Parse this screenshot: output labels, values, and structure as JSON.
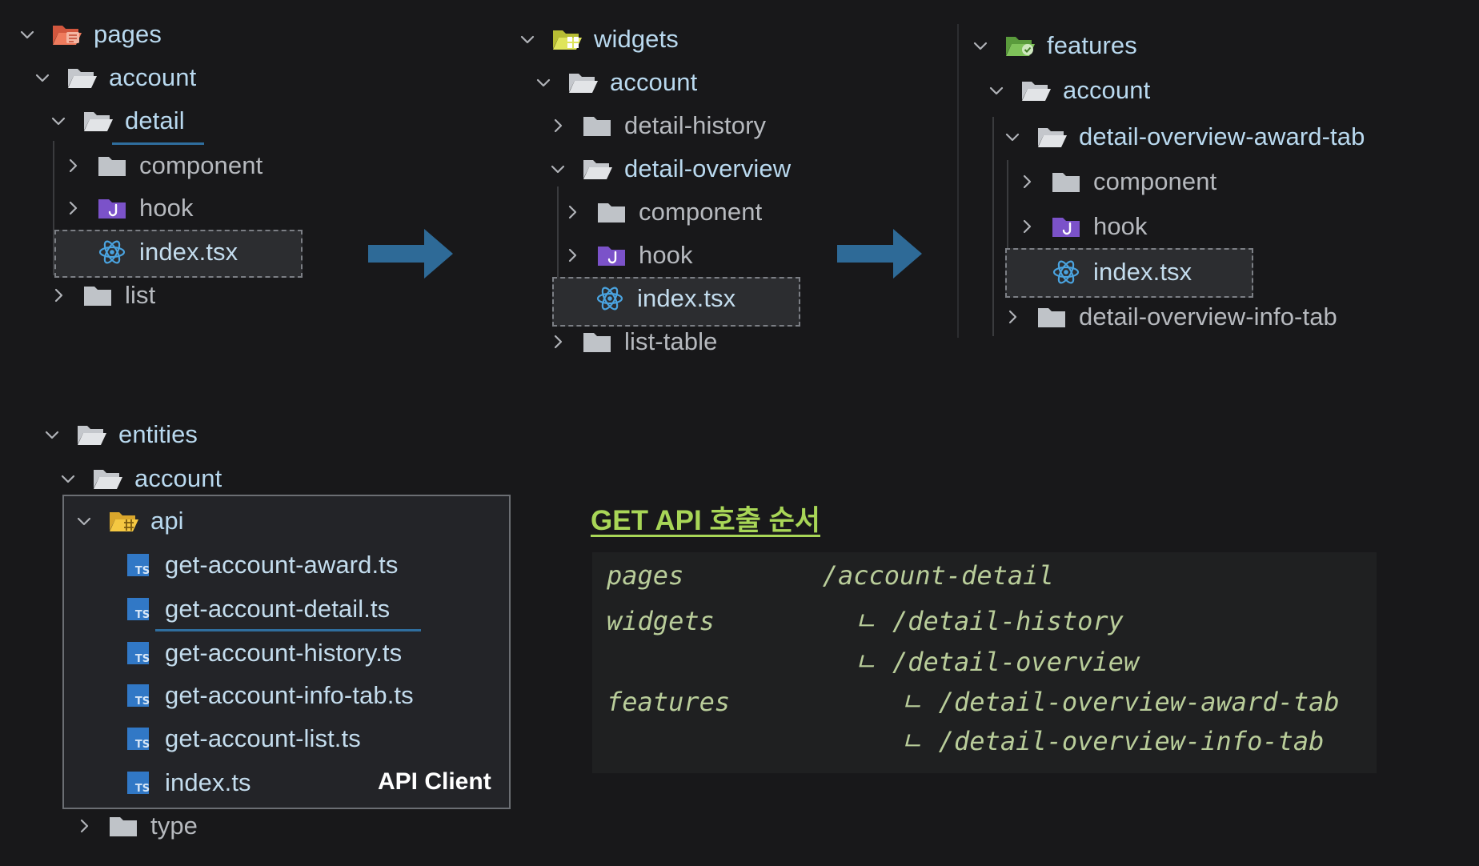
{
  "pages_tree": {
    "root": "pages",
    "account": "account",
    "detail": "detail",
    "component": "component",
    "hook": "hook",
    "index": "index.tsx",
    "list": "list"
  },
  "widgets_tree": {
    "root": "widgets",
    "account": "account",
    "detail_history": "detail-history",
    "detail_overview": "detail-overview",
    "component": "component",
    "hook": "hook",
    "index": "index.tsx",
    "list_table": "list-table"
  },
  "features_tree": {
    "root": "features",
    "account": "account",
    "award_tab": "detail-overview-award-tab",
    "component": "component",
    "hook": "hook",
    "index": "index.tsx",
    "info_tab": "detail-overview-info-tab"
  },
  "entities_tree": {
    "root": "entities",
    "account": "account",
    "api": "api",
    "files": [
      "get-account-award.ts",
      "get-account-detail.ts",
      "get-account-history.ts",
      "get-account-info-tab.ts",
      "get-account-list.ts",
      "index.ts"
    ],
    "type": "type",
    "api_client_label": "API Client"
  },
  "api_order": {
    "title": "GET API 호출 순서",
    "lines": [
      "pages         /account-detail",
      "widgets         ㄴ /detail-history",
      "                ㄴ /detail-overview",
      "features           ㄴ /detail-overview-award-tab",
      "                   ㄴ /detail-overview-info-tab"
    ]
  },
  "colors": {
    "background": "#18181a",
    "arrow": "#2e6a97",
    "title_green": "#a8d657",
    "code_green": "#b9cd9a",
    "folder_gray": "#bfc3c8",
    "hook_purple": "#7b52c9",
    "react_blue": "#4aa3df",
    "ts_blue": "#3178c6"
  }
}
